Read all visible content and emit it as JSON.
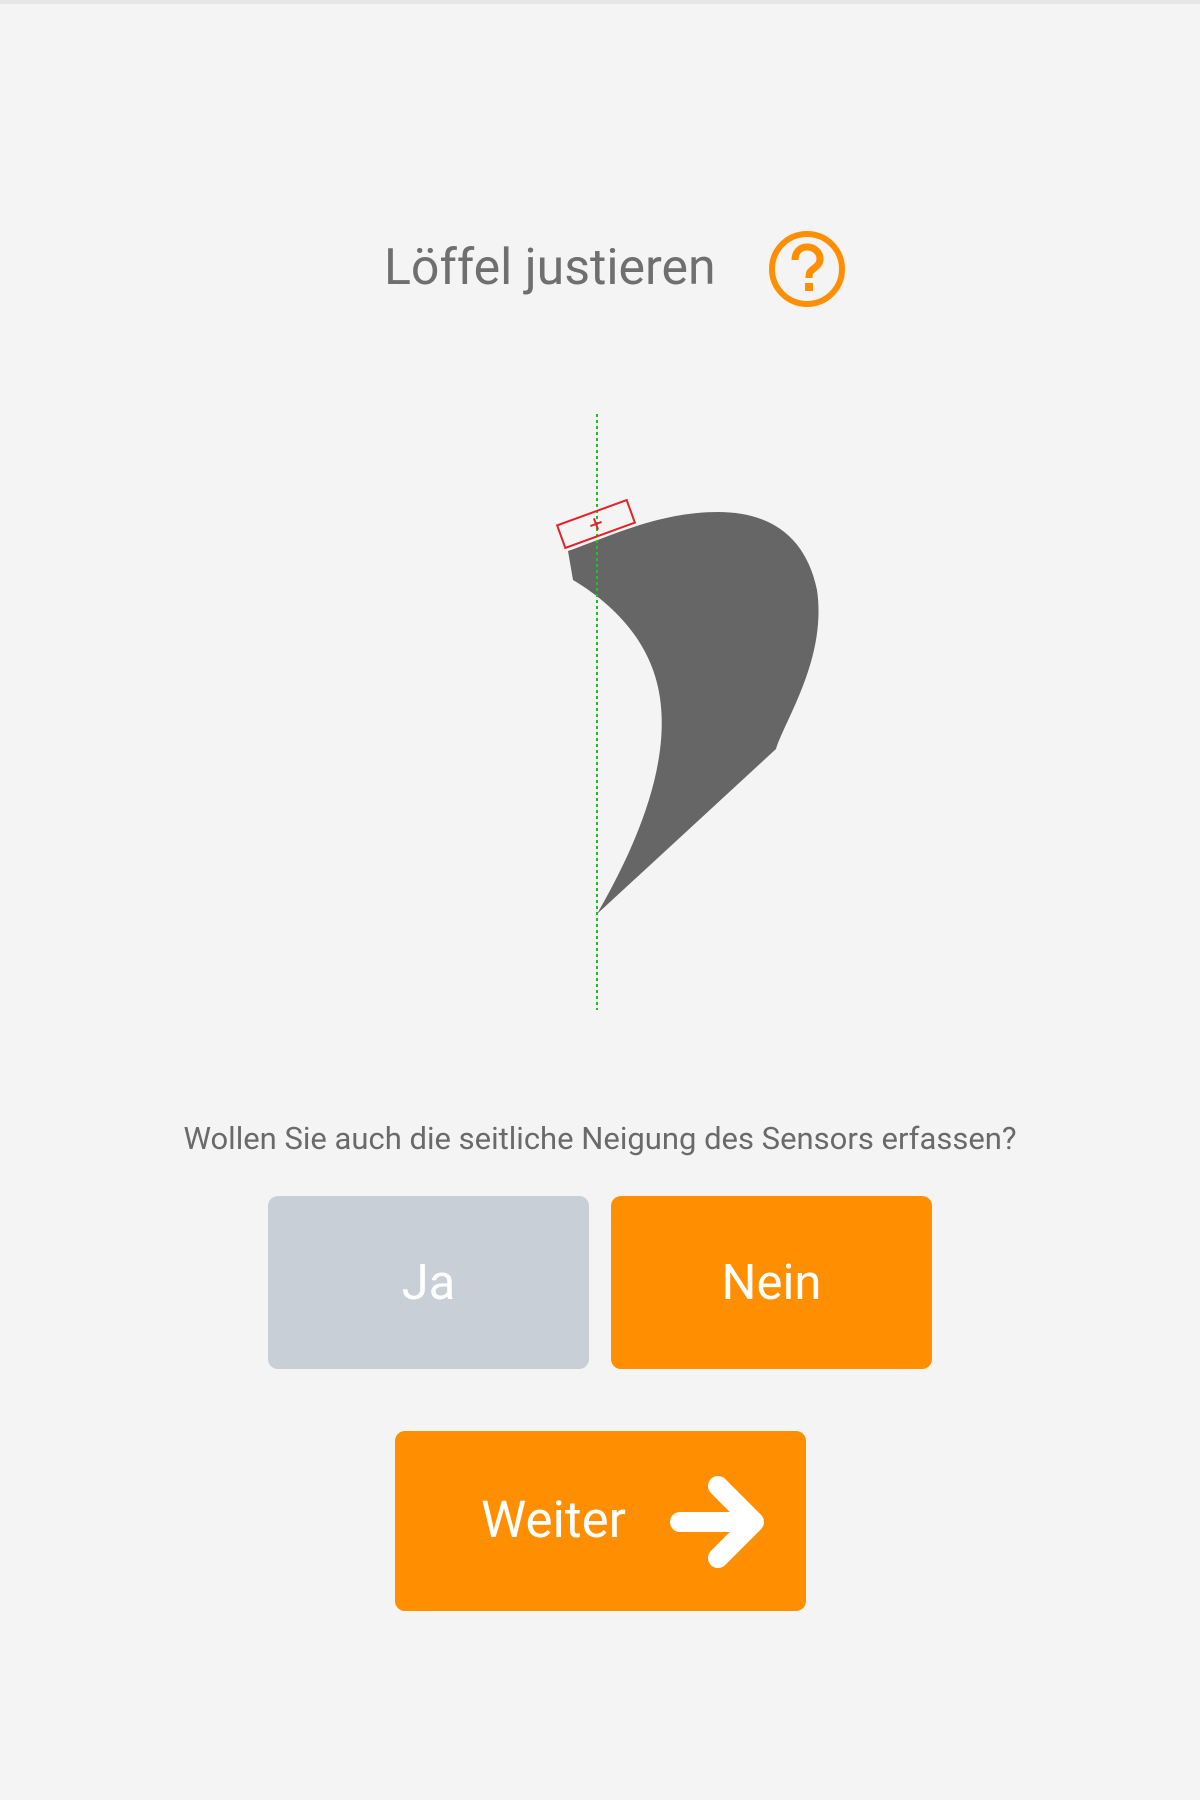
{
  "header": {
    "title": "Löffel justieren",
    "help_icon": "question-circle-icon"
  },
  "figure": {
    "description_icon": "bucket-shape",
    "colors": {
      "bucket": "#666666",
      "reference_line": "#1ec21e",
      "sensor": "#e3232a"
    }
  },
  "prompt": {
    "question": "Wollen Sie auch die seitliche Neigung des Sensors erfassen?"
  },
  "choices": {
    "yes_label": "Ja",
    "no_label": "Nein",
    "selected": "Nein"
  },
  "next": {
    "label": "Weiter",
    "icon": "arrow-right-icon"
  },
  "colors": {
    "accent": "#ff8f00",
    "inactive": "#c8cfd6",
    "background": "#f4f4f4",
    "text": "#6f6f6f"
  }
}
